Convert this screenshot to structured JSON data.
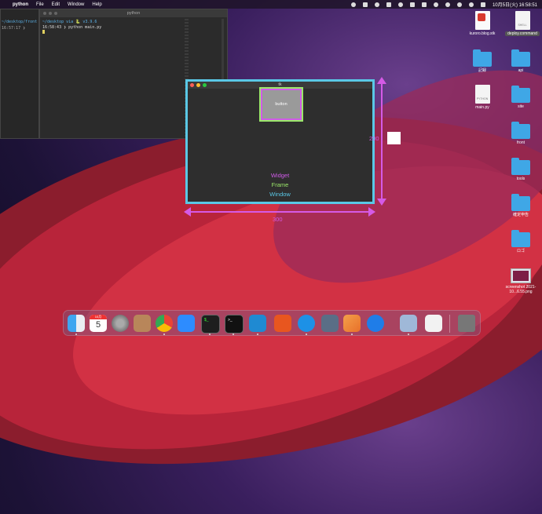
{
  "menubar": {
    "app": "python",
    "items": [
      "File",
      "Edit",
      "Window",
      "Help"
    ],
    "clock": "10月5日(火) 16:58:51"
  },
  "terminal_left": {
    "line1": "~/desktop/front ✓",
    "line2": "16:57:17 ❯"
  },
  "terminal_main": {
    "title": "python",
    "line1": "~/desktop via 🐍 v3.9.6",
    "line2": "16:58:43 ❯ python main.py"
  },
  "tk_window": {
    "title": "tk",
    "button_label": "button",
    "label_widget": "Widget",
    "label_frame": "Frame",
    "label_window": "Window",
    "width_label": "300",
    "height_label": "200",
    "colors": {
      "window": "#5ac8e6",
      "frame": "#9be86a",
      "widget": "#d05be8",
      "arrow": "#d55ae6"
    }
  },
  "desktop_icons": [
    {
      "label": "kuroro.blog.stk",
      "icon": "pdf-doc-icon"
    },
    {
      "label": "deploy.command",
      "icon": "shell-doc-icon",
      "tag": "SHELL"
    },
    {
      "label": "記録",
      "icon": "folder-icon"
    },
    {
      "label": "api",
      "icon": "folder-icon"
    },
    {
      "label": "main.py",
      "icon": "python-doc-icon",
      "tag": "PYTHON"
    },
    {
      "label": "site",
      "icon": "folder-icon"
    },
    {
      "label": "front",
      "icon": "folder-icon"
    },
    {
      "label": "tools",
      "icon": "folder-icon"
    },
    {
      "label": "確定申告",
      "icon": "folder-icon"
    },
    {
      "label": "ロゴ",
      "icon": "folder-icon"
    },
    {
      "label": "screenshot 2021-10...6.55.png",
      "icon": "screenshot-icon"
    }
  ],
  "dock": {
    "calendar_month": "10月",
    "calendar_day": "5",
    "terminal_prompt": "$_",
    "iterm_prompt": ">_"
  }
}
